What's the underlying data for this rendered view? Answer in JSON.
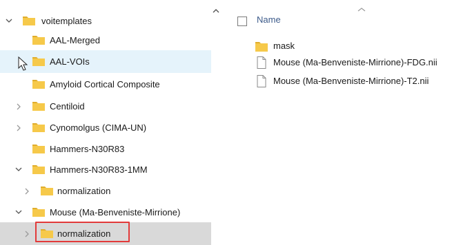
{
  "colors": {
    "folder": "#f6c94a",
    "folder_dark": "#e0ad2c",
    "hover_row": "#e5f3fb",
    "selected_row": "#d9d9d9",
    "highlight_border": "#e23a3a",
    "column_header_text": "#3c5a8a"
  },
  "nav_tree": {
    "items": [
      {
        "label": "voitemplates",
        "expanded": true,
        "state": "normal"
      },
      {
        "label": "AAL-Merged",
        "expanded": null,
        "state": "normal"
      },
      {
        "label": "AAL-VOIs",
        "expanded": null,
        "state": "hover"
      },
      {
        "label": "Amyloid Cortical Composite",
        "expanded": null,
        "state": "normal"
      },
      {
        "label": "Centiloid",
        "expanded": false,
        "state": "normal"
      },
      {
        "label": "Cynomolgus (CIMA-UN)",
        "expanded": false,
        "state": "normal"
      },
      {
        "label": "Hammers-N30R83",
        "expanded": null,
        "state": "normal"
      },
      {
        "label": "Hammers-N30R83-1MM",
        "expanded": true,
        "state": "normal"
      },
      {
        "label": "normalization",
        "expanded": false,
        "state": "normal"
      },
      {
        "label": "Mouse (Ma-Benveniste-Mirrione)",
        "expanded": true,
        "state": "normal"
      },
      {
        "label": "normalization",
        "expanded": false,
        "state": "selected"
      }
    ]
  },
  "file_list": {
    "column_header": "Name",
    "sort_icon": "chevron-up-icon",
    "items": [
      {
        "name": "mask",
        "type": "folder"
      },
      {
        "name": "Mouse (Ma-Benveniste-Mirrione)-FDG.nii",
        "type": "file"
      },
      {
        "name": "Mouse (Ma-Benveniste-Mirrione)-T2.nii",
        "type": "file"
      }
    ]
  }
}
